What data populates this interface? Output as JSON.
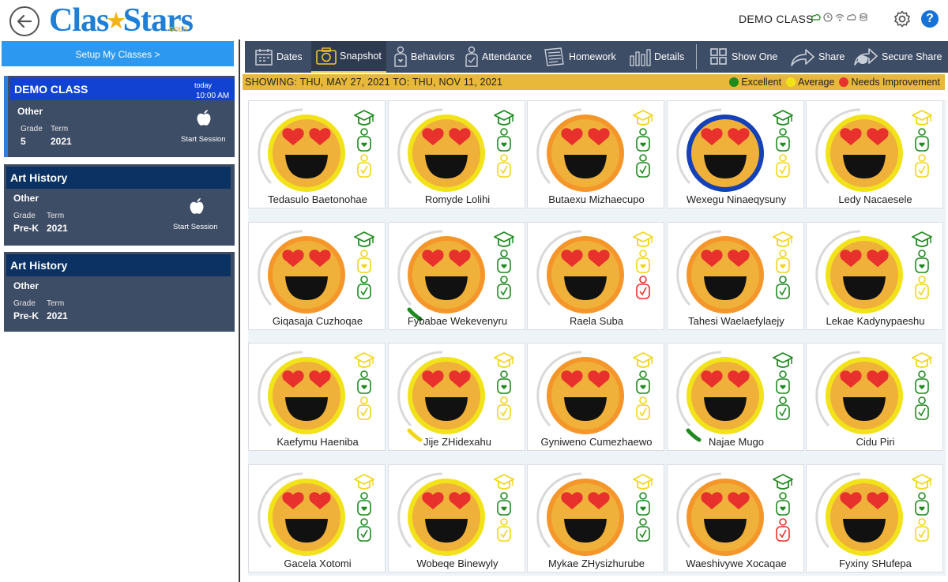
{
  "app": {
    "logo_text": "ClasStars",
    "logo_sub": "GOLD",
    "class_title": "DEMO CLASS",
    "help_label": "?"
  },
  "colors": {
    "excellent": "#1f8a1f",
    "average": "#f2d61a",
    "needs_improvement": "#e8322c",
    "header_blue": "#0b3262",
    "toolbar": "#3e4d66",
    "range_bar": "#e8b83a"
  },
  "sidebar": {
    "setup_label": "Setup My Classes >",
    "classes": [
      {
        "name": "DEMO CLASS",
        "subject": "Other",
        "grade_label": "Grade",
        "term_label": "Term",
        "grade": "5",
        "term": "2021",
        "today": "today",
        "time": "10:00 AM",
        "action": "Start Session",
        "icon": "apple-icon",
        "active": true
      },
      {
        "name": "Art History",
        "subject": "Other",
        "grade_label": "Grade",
        "term_label": "Term",
        "grade": "Pre-K",
        "term": "2021",
        "action": "Start Session",
        "icon": "apple-icon",
        "active": false
      },
      {
        "name": "Art History",
        "subject": "Other",
        "grade_label": "Grade",
        "term_label": "Term",
        "grade": "Pre-K",
        "term": "2021",
        "active": false
      }
    ]
  },
  "toolbar": {
    "items": [
      {
        "label": "Dates",
        "icon": "calendar-icon"
      },
      {
        "label": "Snapshot",
        "icon": "camera-icon",
        "active": true
      },
      {
        "label": "Behaviors",
        "icon": "behavior-person-icon"
      },
      {
        "label": "Attendance",
        "icon": "attendance-person-icon"
      },
      {
        "label": "Homework",
        "icon": "homework-icon"
      },
      {
        "label": "Details",
        "icon": "bar-chart-icon"
      },
      {
        "label": "Show One",
        "icon": "grid-icon"
      },
      {
        "label": "Share",
        "icon": "share-arrow-icon"
      },
      {
        "label": "Secure Share",
        "icon": "secure-share-icon"
      }
    ]
  },
  "range": {
    "text": "SHOWING: THU, MAY 27, 2021 TO: THU, NOV 11, 2021",
    "legend": [
      {
        "label": "Excellent",
        "color": "#1f8a1f"
      },
      {
        "label": "Average",
        "color": "#f2d61a"
      },
      {
        "label": "Needs Improvement",
        "color": "#e8322c"
      }
    ]
  },
  "students": [
    {
      "name": "Tedasulo Baetonohae",
      "ring": "yellow",
      "arc": "none",
      "icons": [
        "green",
        "green",
        "yellow"
      ]
    },
    {
      "name": "Romyde Lolihi",
      "ring": "yellow",
      "arc": "none",
      "icons": [
        "green",
        "green",
        "yellow"
      ]
    },
    {
      "name": "Butaexu Mizhaecupo",
      "ring": "orange",
      "arc": "none",
      "icons": [
        "yellow",
        "green",
        "green"
      ]
    },
    {
      "name": "Wexegu Ninaeqysuny",
      "ring": "blue",
      "arc": "none",
      "icons": [
        "green",
        "green",
        "yellow"
      ]
    },
    {
      "name": "Ledy Nacaesele",
      "ring": "yellow",
      "arc": "none",
      "icons": [
        "yellow",
        "green",
        "yellow"
      ]
    },
    {
      "name": "Giqasaja Cuzhoqae",
      "ring": "orange",
      "arc": "none",
      "icons": [
        "green",
        "yellow",
        "green"
      ]
    },
    {
      "name": "Fybabae Wekevenyru",
      "ring": "orange",
      "arc": "green",
      "icons": [
        "green",
        "green",
        "green"
      ]
    },
    {
      "name": "Raela Suba",
      "ring": "orange",
      "arc": "none",
      "icons": [
        "yellow",
        "yellow",
        "red"
      ]
    },
    {
      "name": "Tahesi Waelaefylaejy",
      "ring": "orange",
      "arc": "none",
      "icons": [
        "yellow",
        "yellow",
        "green"
      ]
    },
    {
      "name": "Lekae Kadynypaeshu",
      "ring": "yellow",
      "arc": "none",
      "icons": [
        "green",
        "green",
        "yellow"
      ]
    },
    {
      "name": "Kaefymu Haeniba",
      "ring": "yellow",
      "arc": "none",
      "icons": [
        "yellow",
        "green",
        "yellow"
      ]
    },
    {
      "name": "Jije ZHidexahu",
      "ring": "yellow",
      "arc": "yellow",
      "icons": [
        "yellow",
        "green",
        "yellow"
      ]
    },
    {
      "name": "Gyniweno Cumezhaewo",
      "ring": "orange",
      "arc": "none",
      "icons": [
        "yellow",
        "green",
        "yellow"
      ]
    },
    {
      "name": "Najae Mugo",
      "ring": "yellow",
      "arc": "green",
      "icons": [
        "green",
        "green",
        "green"
      ]
    },
    {
      "name": "Cidu Piri",
      "ring": "yellow",
      "arc": "none",
      "icons": [
        "yellow",
        "green",
        "green"
      ]
    },
    {
      "name": "Gacela Xotomi",
      "ring": "yellow",
      "arc": "none",
      "icons": [
        "yellow",
        "green",
        "green"
      ]
    },
    {
      "name": "Wobeqe Binewyly",
      "ring": "yellow",
      "arc": "none",
      "icons": [
        "yellow",
        "green",
        "yellow"
      ]
    },
    {
      "name": "Mykae ZHysizhurube",
      "ring": "orange",
      "arc": "none",
      "icons": [
        "yellow",
        "green",
        "green"
      ]
    },
    {
      "name": "Waeshivywe Xocaqae",
      "ring": "orange",
      "arc": "none",
      "icons": [
        "green",
        "green",
        "red"
      ]
    },
    {
      "name": "Fyxiny SHufepa",
      "ring": "yellow",
      "arc": "none",
      "icons": [
        "yellow",
        "green",
        "yellow"
      ]
    }
  ]
}
